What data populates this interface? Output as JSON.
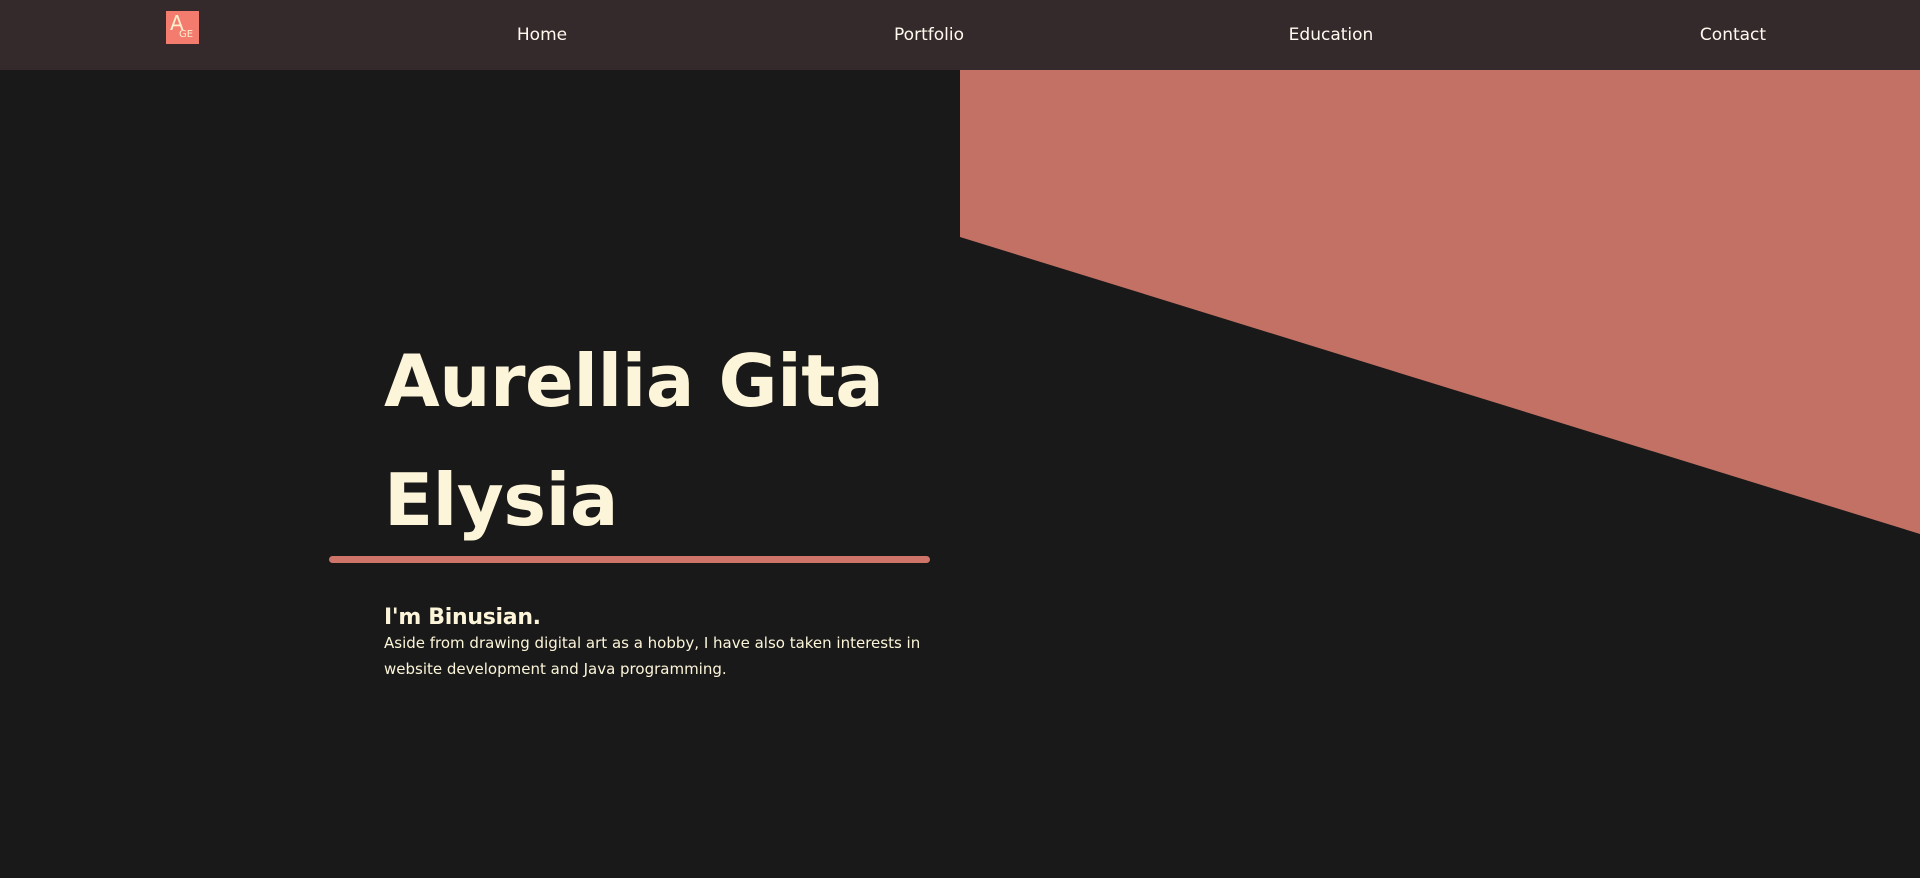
{
  "logo": {
    "main_letter": "A",
    "sub_letters": "GE"
  },
  "nav": {
    "home": "Home",
    "portfolio": "Portfolio",
    "education": "Education",
    "contact": "Contact"
  },
  "hero": {
    "title": "Aurellia Gita Elysia",
    "subheading": "I'm Binusian.",
    "description": "Aside from drawing digital art as a hobby, I have also taken interests in website development and Java programming."
  },
  "colors": {
    "background": "#191919",
    "navbar": "#352a2b",
    "accent": "#c47165",
    "text": "#fcf5d9",
    "logo": "#f47c6f"
  }
}
